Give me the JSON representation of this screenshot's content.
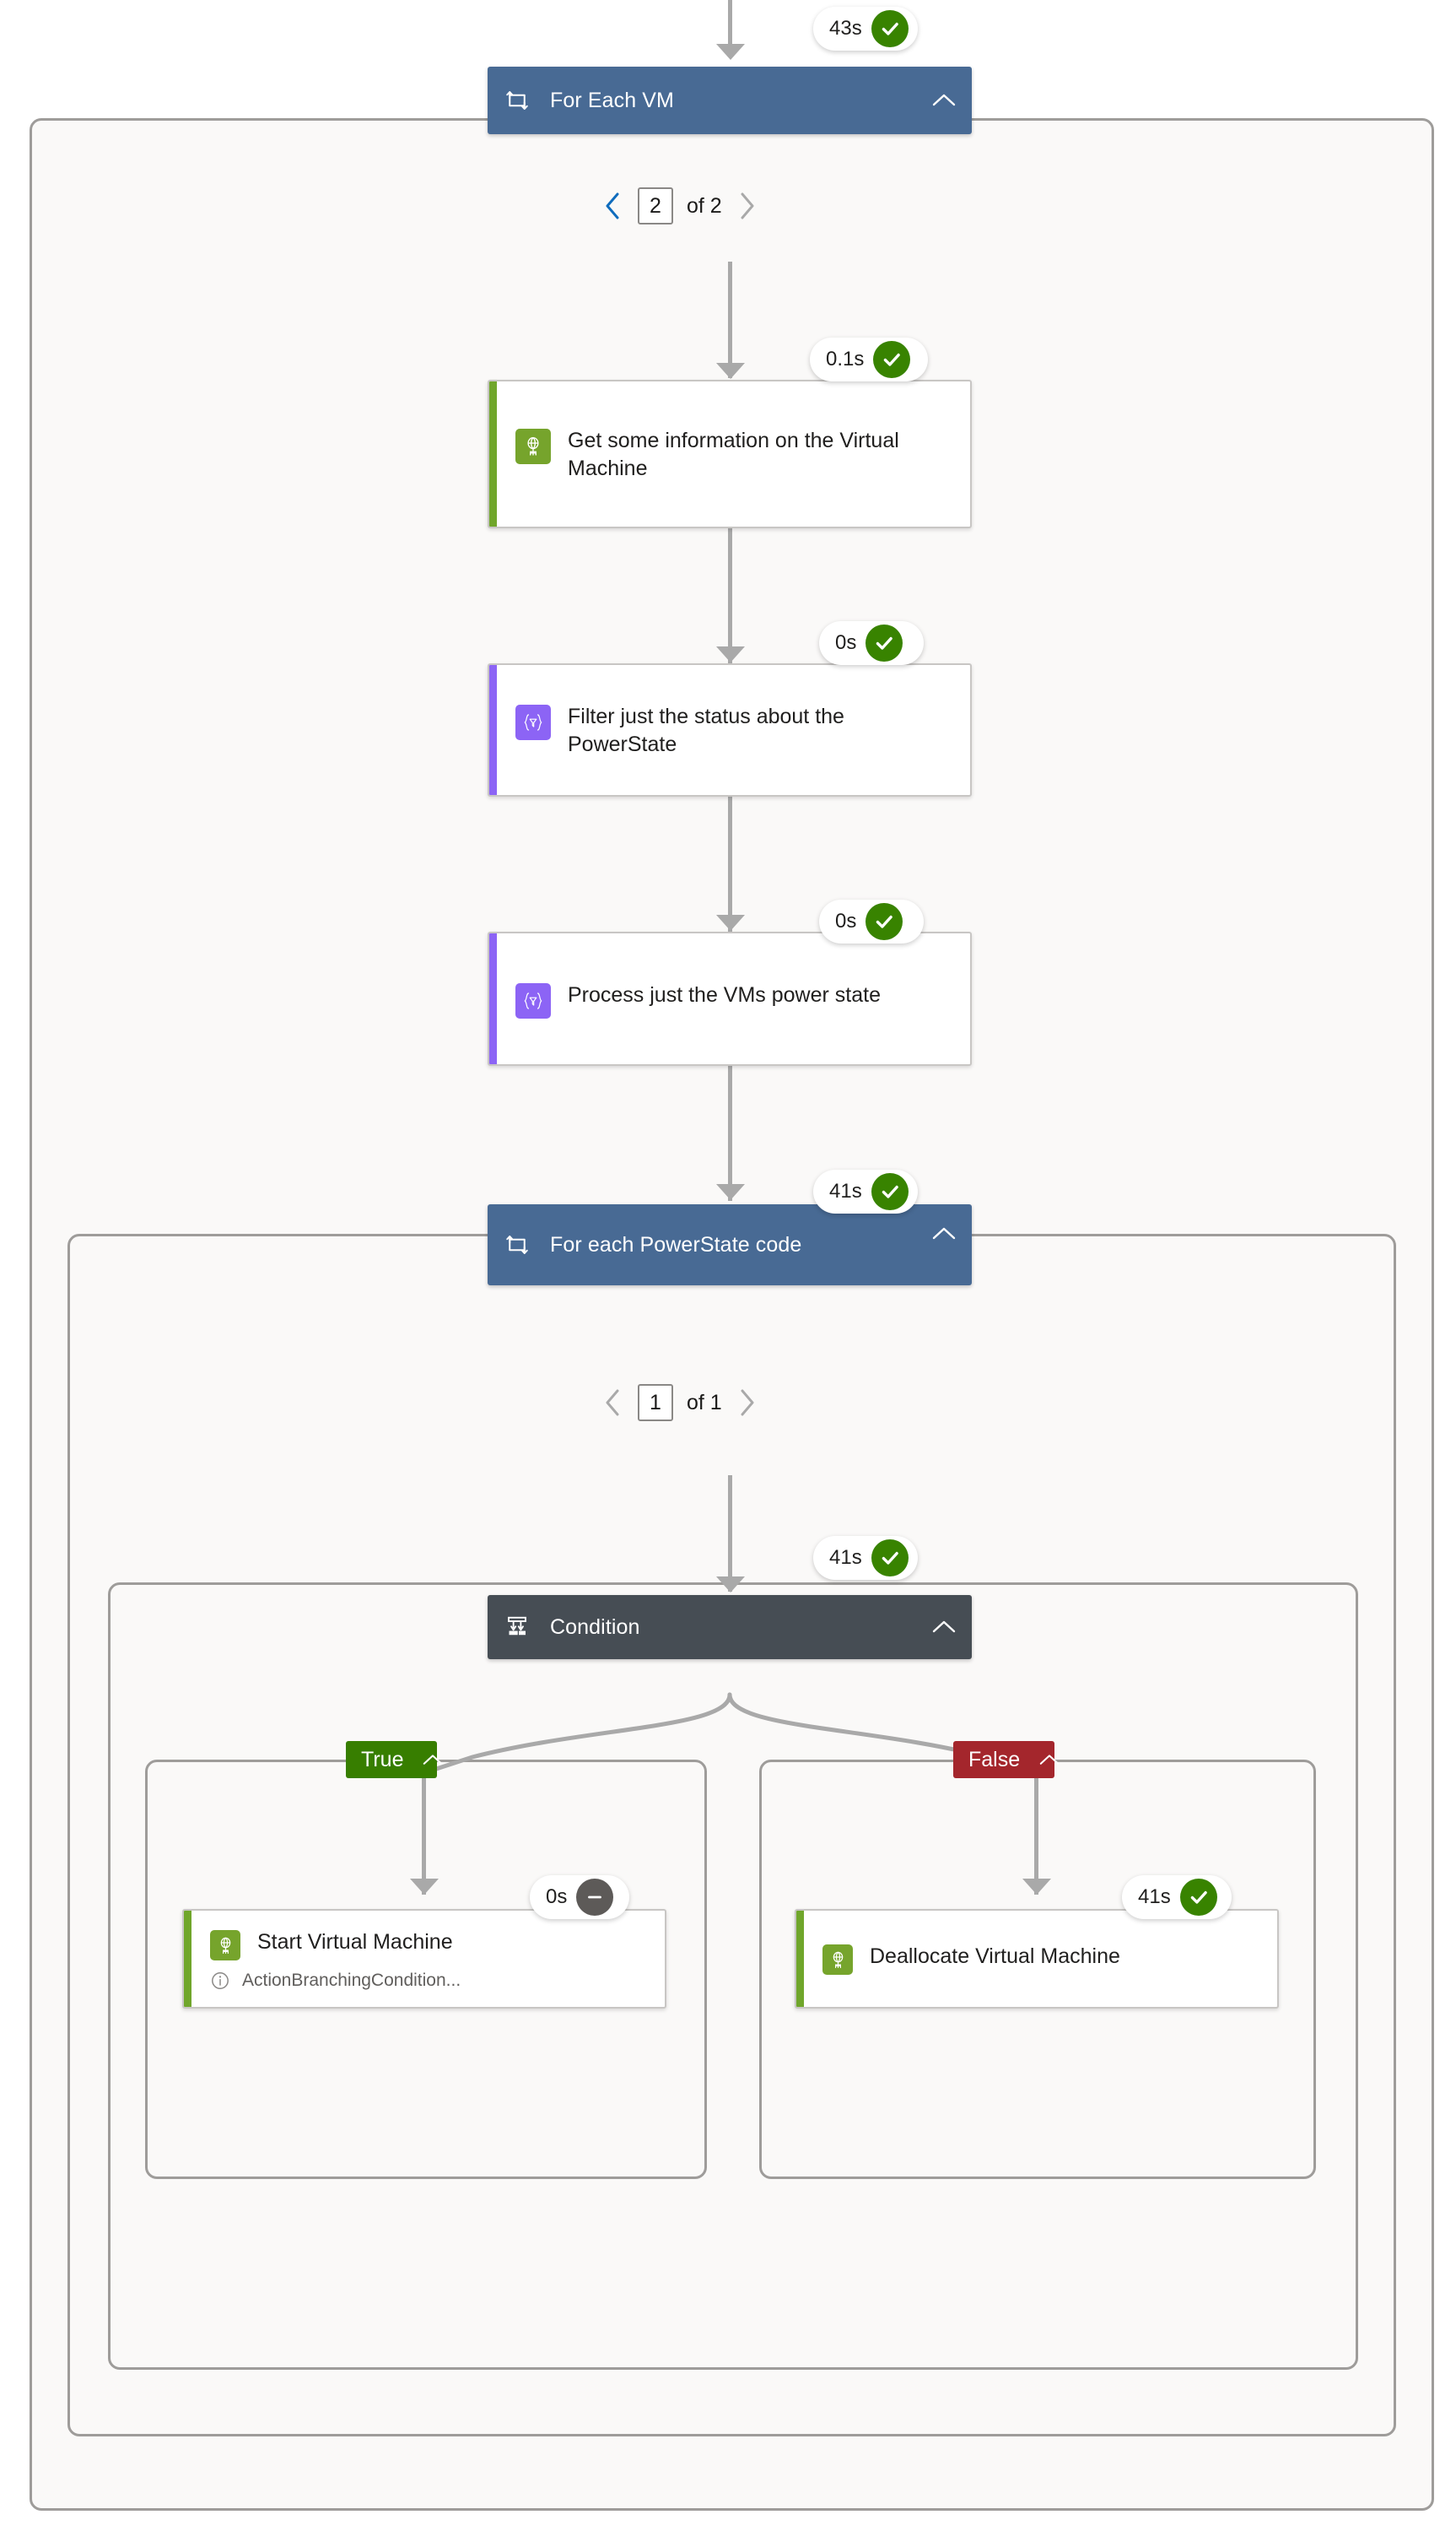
{
  "flow": {
    "type": "power-automate-run-history",
    "background_color": "#ffffff",
    "scope_fill": "#faf9f8",
    "scope_border": "#9e9c9a",
    "connector_color": "#a9a9a9"
  },
  "top_connector": {
    "present": true
  },
  "foreach_vm": {
    "title": "For Each VM",
    "icon": "loop-icon",
    "chevron": "chevron-up-icon",
    "header_color": "#486a94",
    "status": {
      "duration": "43s",
      "state": "succeeded",
      "icon": "check-icon",
      "color": "#388300"
    },
    "pager": {
      "prev_icon": "chevron-left-icon",
      "next_icon": "chevron-right-icon",
      "prev_enabled": true,
      "next_enabled": false,
      "page_value": "2",
      "of_label": "of 2"
    }
  },
  "actions": {
    "get_info": {
      "title": "Get some information on the Virtual Machine",
      "icon": "azure-vm-icon",
      "icon_color": "#76a42c",
      "accent_color": "#70a62b",
      "status": {
        "duration": "0.1s",
        "state": "succeeded",
        "icon": "check-icon",
        "color": "#388300"
      }
    },
    "filter_status": {
      "title": "Filter just the status about the PowerState",
      "icon": "data-operation-filter-icon",
      "icon_color": "#8c64f5",
      "accent_color": "#8c64f5",
      "status": {
        "duration": "0s",
        "state": "succeeded",
        "icon": "check-icon",
        "color": "#388300"
      }
    },
    "process_power_state": {
      "title": "Process just the VMs power state",
      "icon": "data-operation-filter-icon",
      "icon_color": "#8c64f5",
      "accent_color": "#8c64f5",
      "status": {
        "duration": "0s",
        "state": "succeeded",
        "icon": "check-icon",
        "color": "#388300"
      }
    },
    "start_vm": {
      "title": "Start Virtual Machine",
      "icon": "azure-vm-icon",
      "icon_color": "#76a42c",
      "accent_color": "#70a62b",
      "note_icon": "info-icon",
      "note": "ActionBranchingCondition...",
      "status": {
        "duration": "0s",
        "state": "skipped",
        "icon": "minus-icon",
        "color": "#5d5a58"
      }
    },
    "deallocate_vm": {
      "title": "Deallocate Virtual Machine",
      "icon": "azure-vm-icon",
      "icon_color": "#76a42c",
      "accent_color": "#70a62b",
      "status": {
        "duration": "41s",
        "state": "succeeded",
        "icon": "check-icon",
        "color": "#388300"
      }
    }
  },
  "foreach_powerstate": {
    "title": "For each PowerState code",
    "icon": "loop-icon",
    "chevron": "chevron-up-icon",
    "header_color": "#486a94",
    "status": {
      "duration": "41s",
      "state": "succeeded",
      "icon": "check-icon",
      "color": "#388300"
    },
    "pager": {
      "prev_icon": "chevron-left-icon",
      "next_icon": "chevron-right-icon",
      "prev_enabled": false,
      "next_enabled": false,
      "page_value": "1",
      "of_label": "of 1"
    }
  },
  "condition": {
    "title": "Condition",
    "icon": "condition-branch-icon",
    "chevron": "chevron-up-icon",
    "header_color": "#464d54",
    "status": {
      "duration": "41s",
      "state": "succeeded",
      "icon": "check-icon",
      "color": "#388300"
    },
    "branches": {
      "true": {
        "label": "True",
        "color": "#377e00",
        "chevron": "chevron-up-icon"
      },
      "false": {
        "label": "False",
        "color": "#a4262c",
        "chevron": "chevron-up-icon"
      }
    }
  }
}
